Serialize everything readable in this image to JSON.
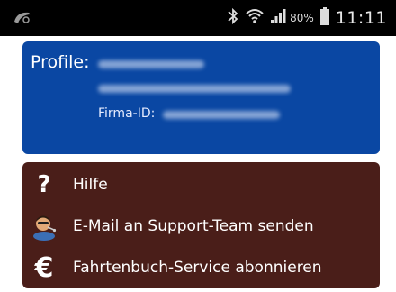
{
  "status_bar": {
    "battery_percent": "80%",
    "time": "11:11",
    "icons": [
      "app-notification-icon",
      "bluetooth-icon",
      "wifi-icon",
      "signal-icon",
      "battery-icon"
    ]
  },
  "profile": {
    "label": "Profile:",
    "firma_label": "Firma-ID:"
  },
  "menu": {
    "items": [
      {
        "label": "Hilfe",
        "icon": "question-mark-icon"
      },
      {
        "label": "E-Mail an Support-Team senden",
        "icon": "support-agent-icon"
      },
      {
        "label": "Fahrtenbuch-Service abonnieren",
        "icon": "euro-icon"
      }
    ]
  },
  "colors": {
    "status_bar_bg": "#000000",
    "profile_bg": "#0a47a3",
    "menu_bg": "#4a1e19",
    "text": "#ffffff"
  }
}
